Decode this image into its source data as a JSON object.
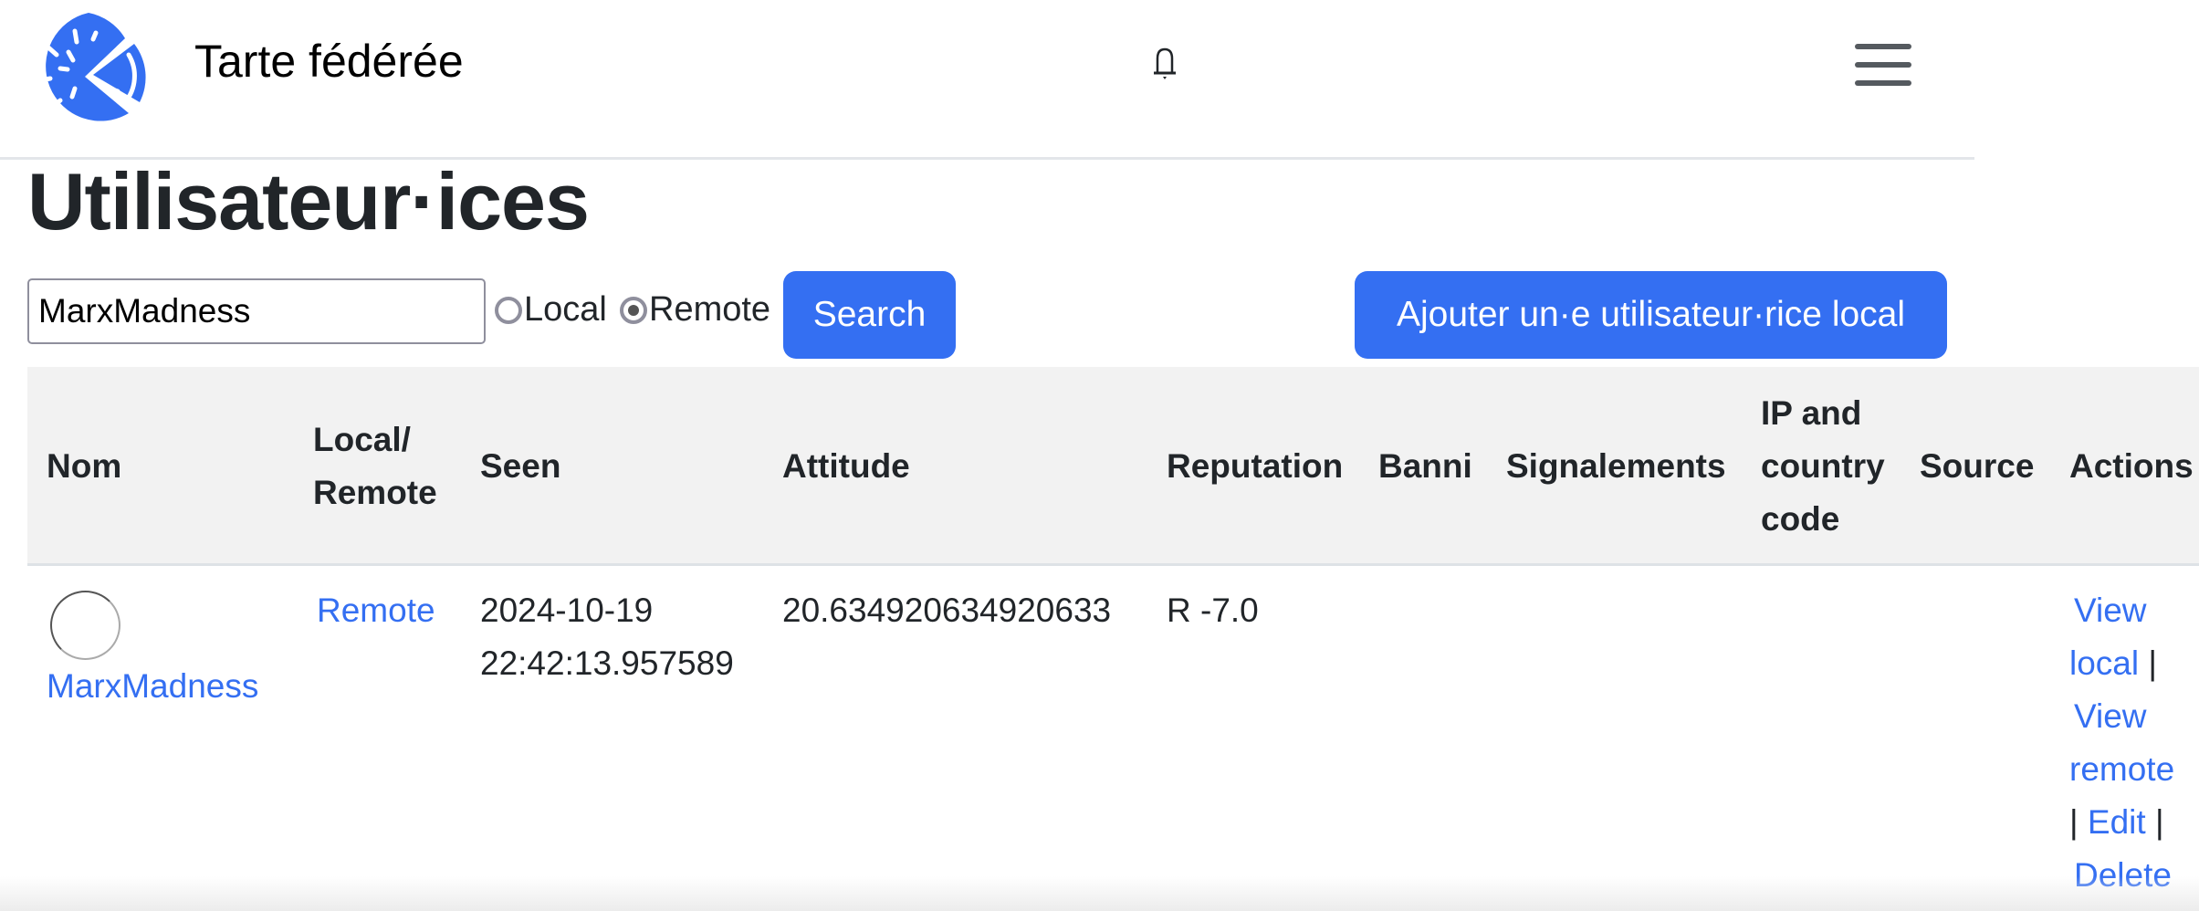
{
  "header": {
    "brand": "Tarte fédérée",
    "logo_icon": "pie-logo-icon",
    "notifications_icon": "bell-icon",
    "menu_icon": "hamburger-menu-icon",
    "accent_color": "#346ff2"
  },
  "page": {
    "title": "Utilisateur·ices"
  },
  "search": {
    "value": "MarxMadness",
    "placeholder": "",
    "scope_options": [
      {
        "label": "Local",
        "checked": false
      },
      {
        "label": "Remote",
        "checked": true
      }
    ],
    "search_label": "Search",
    "add_label": "Ajouter un·e utilisateur·rice local"
  },
  "table": {
    "columns": {
      "nom": "Nom",
      "local_remote_1": "Local/",
      "local_remote_2": "Remote",
      "seen": "Seen",
      "attitude": "Attitude",
      "reputation": "Reputation",
      "banni": "Banni",
      "signalements": "Signalements",
      "ip_1": "IP and",
      "ip_2": "country",
      "ip_3": "code",
      "source": "Source",
      "actions": "Actions"
    },
    "rows": [
      {
        "avatar": "broken-avatar-image",
        "name": "MarxMadness",
        "local_remote": "Remote",
        "seen_date": "2024-10-19",
        "seen_time": "22:42:13.957589",
        "attitude": "20.634920634920633",
        "reputation": "R -7.0",
        "banni": "",
        "signalements": "",
        "ip_country": "",
        "source": "",
        "actions": {
          "view_local_1": "View",
          "view_local_2": "local",
          "view_remote_1": "View",
          "view_remote_2": "remote",
          "edit": "Edit",
          "delete": "Delete",
          "separator": "|"
        }
      }
    ]
  }
}
